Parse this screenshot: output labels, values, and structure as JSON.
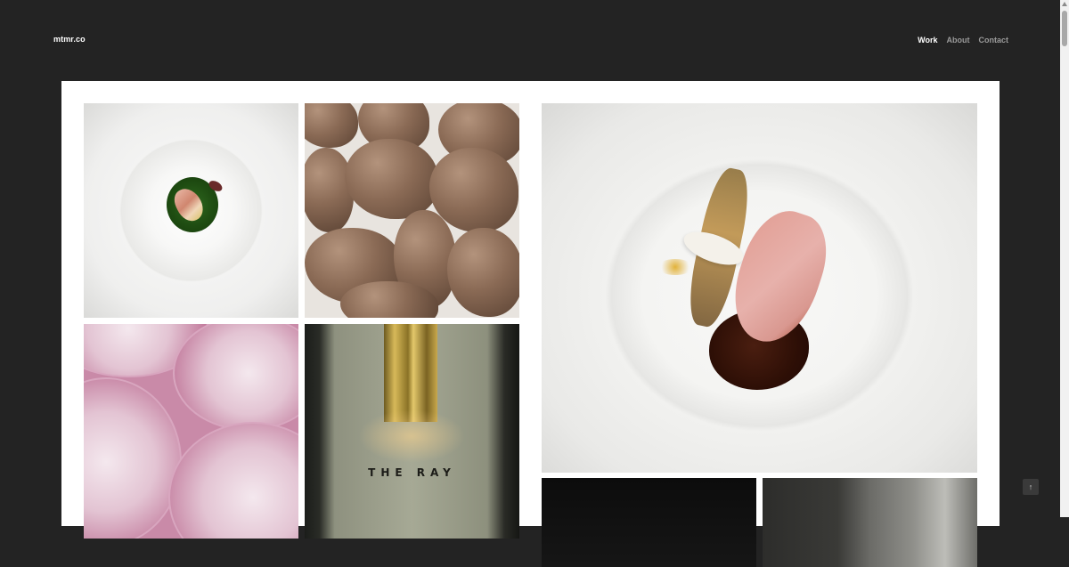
{
  "site": {
    "logo": "mtmr.co"
  },
  "nav": {
    "items": [
      {
        "label": "Work",
        "active": true
      },
      {
        "label": "About",
        "active": false
      },
      {
        "label": "Contact",
        "active": false
      }
    ]
  },
  "gallery": {
    "tiles": [
      {
        "subject": "plated dish with green sauce"
      },
      {
        "subject": "sunchokes"
      },
      {
        "subject": "plated duck with jus"
      },
      {
        "subject": "watermelon radish slices"
      },
      {
        "subject": "brass sign",
        "sign_text": "THE RAY"
      },
      {
        "subject": "dark interior"
      },
      {
        "subject": "interior with window"
      }
    ]
  },
  "controls": {
    "back_to_top_icon": "arrow-up-icon",
    "back_to_top_glyph": "↑"
  },
  "colors": {
    "background": "#232323",
    "panel": "#ffffff",
    "nav_active": "#ffffff",
    "nav_inactive": "#9a9a9a"
  }
}
